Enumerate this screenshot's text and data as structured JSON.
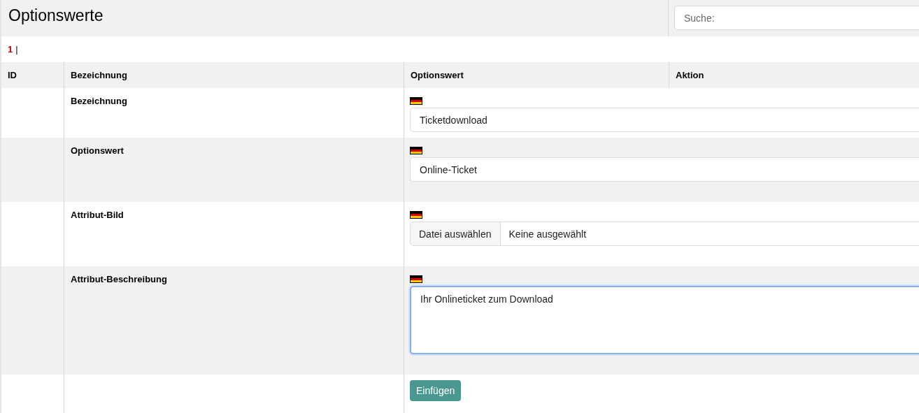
{
  "title": "Optionswerte",
  "search": {
    "placeholder": "Suche:"
  },
  "pagination": {
    "current": "1",
    "separator": "|"
  },
  "table": {
    "columns": [
      "ID",
      "Bezeichnung",
      "Optionswert",
      "Aktion"
    ],
    "rows": [
      {
        "label": "Bezeichnung",
        "kind": "text",
        "value": "Ticketdownload"
      },
      {
        "label": "Optionswert",
        "kind": "text",
        "value": "Online-Ticket"
      },
      {
        "label": "Attribut-Bild",
        "kind": "file",
        "button": "Datei auswählen",
        "status": "Keine ausgewählt"
      },
      {
        "label": "Attribut-Beschreibung",
        "kind": "textarea",
        "value": "Ihr Onlineticket zum Download",
        "focused": true
      }
    ]
  },
  "submit": "Einfügen"
}
